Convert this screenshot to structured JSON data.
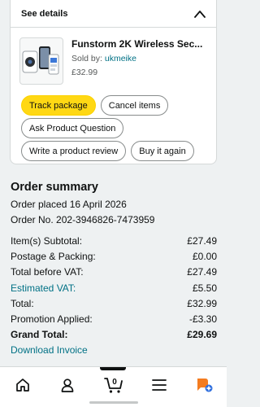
{
  "details": {
    "header": "See details",
    "toggle_icon": "chevron-up-icon",
    "product": {
      "name": "Funstorm 2K Wireless Sec...",
      "sold_by_label": "Sold by:",
      "seller": "ukmeike",
      "price": "£32.99"
    },
    "buttons": {
      "track": "Track package",
      "cancel": "Cancel items",
      "ask": "Ask Product Question",
      "review": "Write a product review",
      "buy_again": "Buy it again"
    }
  },
  "summary": {
    "title": "Order summary",
    "placed": "Order placed 16 April 2026",
    "order_no": "Order No. 202-3946826-7473959",
    "rows": [
      {
        "label": "Item(s) Subtotal:",
        "value": "£27.49"
      },
      {
        "label": "Postage & Packing:",
        "value": "£0.00"
      },
      {
        "label": "Total before VAT:",
        "value": "£27.49"
      },
      {
        "label": "Estimated VAT:",
        "value": "£5.50"
      },
      {
        "label": "Total:",
        "value": "£32.99"
      },
      {
        "label": "Promotion Applied:",
        "value": "-£3.30"
      },
      {
        "label": "Grand Total:",
        "value": "£29.69"
      }
    ],
    "download": "Download Invoice"
  },
  "nav": {
    "cart_count": "0",
    "icons": [
      "home-icon",
      "account-icon",
      "cart-icon",
      "menu-icon",
      "assistant-icon"
    ]
  },
  "colors": {
    "accent_yellow": "#ffd814",
    "link_teal": "#007185",
    "text": "#0f1111"
  }
}
